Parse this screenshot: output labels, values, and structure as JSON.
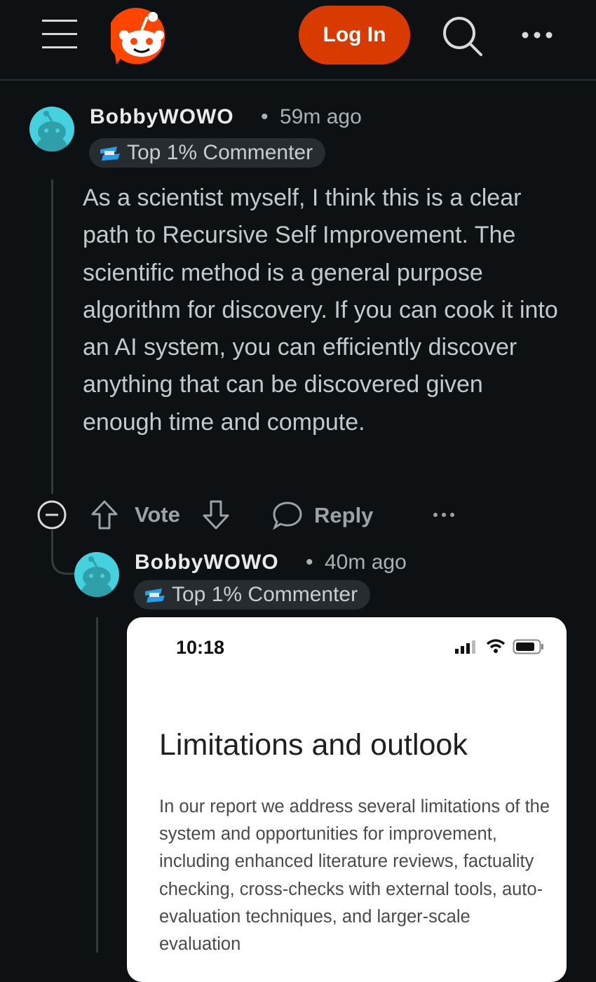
{
  "header": {
    "login_label": "Log In",
    "menu_icon": "hamburger-menu-icon",
    "logo_icon": "reddit-logo-icon",
    "search_icon": "search-icon",
    "more_icon": "more-options-icon",
    "accent_color": "#d93a00"
  },
  "comments": [
    {
      "username": "BobbyWOWO",
      "separator": "•",
      "timestamp": "59m ago",
      "badge": "Top 1% Commenter",
      "text": "As a scientist myself, I think this is a clear path to Recursive Self Improvement. The scientific method is a general purpose algorithm for discovery. If you can cook it into an AI system, you can efficiently discover anything that can be discovered given enough time and compute.",
      "actions": {
        "vote_label": "Vote",
        "reply_label": "Reply"
      }
    },
    {
      "username": "BobbyWOWO",
      "separator": "•",
      "timestamp": "40m ago",
      "badge": "Top 1% Commenter",
      "embedded_screenshot": {
        "time": "10:18",
        "title": "Limitations and outlook",
        "body": "In our report we address several limitations of the system and opportunities for improvement, including enhanced literature reviews, factuality checking, cross-checks with external tools, auto-evaluation techniques, and larger-scale evaluation"
      }
    }
  ]
}
